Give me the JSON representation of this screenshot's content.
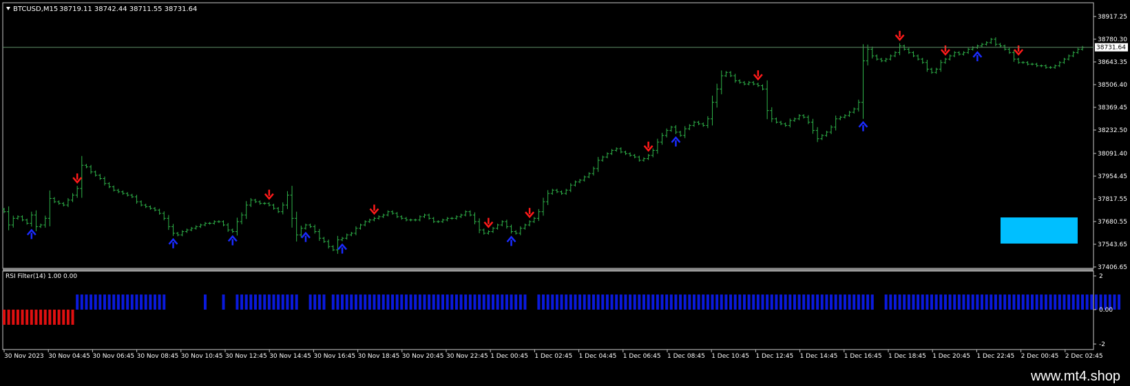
{
  "header": {
    "symbol": "BTCUSD,M15",
    "ohlc": "38719.11 38742.44 38711.55 38731.64"
  },
  "price_axis": {
    "ticks": [
      "38917.25",
      "38780.30",
      "38643.35",
      "38506.40",
      "38369.45",
      "38232.50",
      "38091.40",
      "37954.45",
      "37817.55",
      "37680.55",
      "37543.65",
      "37406.65"
    ],
    "current_price": "38731.64"
  },
  "indicator": {
    "title": "RSI Filter(14) 1.00 0.00",
    "ticks": [
      "2",
      "0.00",
      "-2"
    ]
  },
  "time_axis": {
    "ticks": [
      "30 Nov 2023",
      "30 Nov 04:45",
      "30 Nov 06:45",
      "30 Nov 08:45",
      "30 Nov 10:45",
      "30 Nov 12:45",
      "30 Nov 14:45",
      "30 Nov 16:45",
      "30 Nov 18:45",
      "30 Nov 20:45",
      "30 Nov 22:45",
      "1 Dec 00:45",
      "1 Dec 02:45",
      "1 Dec 04:45",
      "1 Dec 06:45",
      "1 Dec 08:45",
      "1 Dec 10:45",
      "1 Dec 12:45",
      "1 Dec 14:45",
      "1 Dec 16:45",
      "1 Dec 18:45",
      "1 Dec 20:45",
      "1 Dec 22:45",
      "2 Dec 00:45",
      "2 Dec 02:45"
    ]
  },
  "watermark": "www.mt4.shop",
  "colors": {
    "background": "#000000",
    "bars": "#2fb54a",
    "sell_arrow": "#ff1a1a",
    "buy_arrow": "#1a2bff",
    "rsi_positive": "#0a1adc",
    "rsi_negative": "#e01010",
    "price_line": "#5e8c66",
    "box": "#00bfff"
  },
  "chart_data": {
    "type": "ohlc",
    "series": [
      {
        "values": [
          37740,
          37660,
          37700,
          37710,
          37690,
          37670,
          37720,
          37650,
          37660,
          37700,
          37820,
          37800,
          37790,
          37780,
          37810,
          37840,
          37880,
          38020,
          38010,
          37980,
          37960,
          37940,
          37910,
          37890,
          37870,
          37860,
          37850,
          37840,
          37830,
          37800,
          37780,
          37770,
          37760,
          37750,
          37730,
          37700,
          37650,
          37610,
          37600,
          37620,
          37630,
          37640,
          37650,
          37660,
          37670,
          37670,
          37680,
          37680,
          37660,
          37630,
          37620,
          37680,
          37720,
          37780,
          37810,
          37800,
          37790,
          37790,
          37780,
          37760,
          37740,
          37780,
          37840,
          37700,
          37600,
          37640,
          37660,
          37650,
          37620,
          37580,
          37560,
          37530,
          37510,
          37570,
          37580,
          37600,
          37610,
          37640,
          37660,
          37680,
          37690,
          37700,
          37710,
          37720,
          37740,
          37730,
          37710,
          37700,
          37690,
          37690,
          37690,
          37710,
          37720,
          37700,
          37680,
          37680,
          37690,
          37700,
          37700,
          37710,
          37720,
          37740,
          37720,
          37680,
          37630,
          37610,
          37620,
          37640,
          37660,
          37680,
          37650,
          37620,
          37610,
          37640,
          37660,
          37680,
          37700,
          37740,
          37800,
          37850,
          37870,
          37860,
          37850,
          37870,
          37900,
          37920,
          37930,
          37950,
          37970,
          38000,
          38050,
          38070,
          38090,
          38110,
          38120,
          38100,
          38090,
          38080,
          38070,
          38050,
          38060,
          38080,
          38110,
          38160,
          38200,
          38230,
          38250,
          38220,
          38200,
          38240,
          38260,
          38280,
          38270,
          38260,
          38300,
          38400,
          38480,
          38560,
          38580,
          38560,
          38530,
          38520,
          38510,
          38520,
          38510,
          38500,
          38480,
          38350,
          38300,
          38280,
          38270,
          38260,
          38290,
          38300,
          38320,
          38310,
          38280,
          38230,
          38180,
          38200,
          38220,
          38250,
          38300,
          38310,
          38320,
          38340,
          38360,
          38400,
          38650,
          38720,
          38680,
          38660,
          38650,
          38660,
          38680,
          38700,
          38740,
          38720,
          38700,
          38680,
          38660,
          38640,
          38600,
          38580,
          38600,
          38640,
          38660,
          38680,
          38700,
          38690,
          38700,
          38720,
          38730,
          38740,
          38750,
          38760,
          38780,
          38750,
          38740,
          38720,
          38700,
          38660,
          38640,
          38640,
          38630,
          38630,
          38620,
          38620,
          38610,
          38610,
          38620,
          38640,
          38660,
          38680,
          38700,
          38720,
          38731.64
        ]
      }
    ],
    "sell_signals": [
      16,
      58,
      81,
      106,
      115,
      141,
      165,
      196,
      206,
      222
    ],
    "buy_signals": [
      6,
      37,
      50,
      66,
      74,
      111,
      147,
      188,
      213
    ],
    "rsi_filter": [
      -1,
      -1,
      -1,
      -1,
      -1,
      -1,
      -1,
      -1,
      -1,
      -1,
      -1,
      -1,
      -1,
      -1,
      -1,
      -1,
      1,
      1,
      1,
      1,
      1,
      1,
      1,
      1,
      1,
      1,
      1,
      1,
      1,
      1,
      1,
      1,
      1,
      1,
      1,
      1,
      0,
      0,
      0,
      0,
      0,
      0,
      0,
      0,
      1,
      0,
      0,
      0,
      1,
      0,
      0,
      1,
      1,
      1,
      1,
      1,
      1,
      1,
      1,
      1,
      1,
      1,
      1,
      1,
      1,
      0,
      0,
      1,
      1,
      1,
      1,
      0,
      1,
      1,
      1,
      1,
      1,
      1,
      1,
      1,
      1,
      1,
      1,
      1,
      1,
      1,
      1,
      1,
      1,
      1,
      1,
      1,
      1,
      1,
      1,
      1,
      1,
      1,
      1,
      1,
      1,
      1,
      1,
      1,
      1,
      1,
      1,
      1,
      1,
      1,
      1,
      1,
      1,
      1,
      1,
      0,
      0,
      1,
      1,
      1,
      1,
      1,
      1,
      1,
      1,
      1,
      1,
      1,
      1,
      1,
      1,
      1,
      1,
      1,
      1,
      1,
      1,
      1,
      1,
      1,
      1,
      1,
      1,
      1,
      1,
      1,
      1,
      1,
      1,
      1,
      1,
      1,
      1,
      1,
      1,
      1,
      1,
      1,
      1,
      1,
      1,
      1,
      1,
      1,
      1,
      1,
      1,
      1,
      1,
      1,
      1,
      1,
      1,
      1,
      1,
      1,
      1,
      1,
      1,
      1,
      1,
      1,
      1,
      1,
      1,
      1,
      1,
      1,
      1,
      1,
      1,
      0,
      0,
      1,
      1,
      1,
      1,
      1,
      1,
      1,
      1,
      1,
      1,
      1,
      1,
      1,
      1,
      1,
      1,
      1,
      1,
      1,
      1,
      1,
      1,
      1,
      1,
      1,
      1,
      1,
      1,
      1,
      1,
      1,
      1,
      1,
      1,
      1,
      1,
      1,
      1,
      1,
      1,
      1,
      1,
      1,
      1,
      1,
      1,
      1,
      1,
      1,
      1,
      1,
      1
    ],
    "ylim": [
      37406.65,
      38917.25
    ],
    "indicator_ylim": [
      -2,
      2
    ],
    "grid": false
  }
}
